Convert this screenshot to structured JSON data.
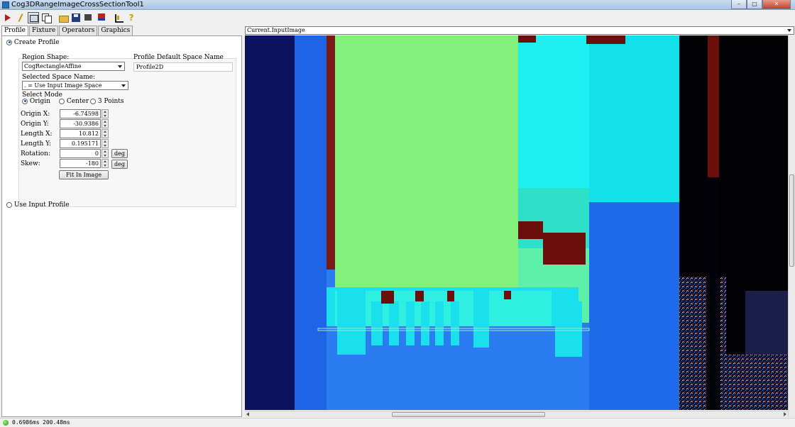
{
  "window": {
    "title": "Cog3DRangeImageCrossSectionTool1",
    "controls": [
      "–",
      "□",
      "✕"
    ]
  },
  "toolbar": {
    "icons": [
      "run-icon",
      "magic-wand-icon",
      "display-icon",
      "pages-icon",
      "open-folder-icon",
      "save-icon",
      "copy-icon",
      "flag-icon",
      "chart-icon",
      "help-icon"
    ]
  },
  "tabs": [
    "Profile",
    "Fixture",
    "Operators",
    "Graphics"
  ],
  "profile": {
    "create_profile_label": "Create Profile",
    "region_shape_label": "Region Shape:",
    "region_shape_value": "CogRectangleAffine",
    "default_space_label": "Profile Default Space Name",
    "default_space_value": "Profile2D",
    "selected_space_label": "Selected Space Name:",
    "selected_space_value": ". = Use Input Image Space",
    "select_mode_label": "Select Mode",
    "modes": [
      "Origin",
      "Center",
      "3 Points"
    ],
    "selected_mode": "Origin",
    "fields": [
      {
        "label": "Origin X:",
        "value": "-6.74598"
      },
      {
        "label": "Origin Y:",
        "value": "-30.9386"
      },
      {
        "label": "Length X:",
        "value": "10.812"
      },
      {
        "label": "Length Y:",
        "value": "0.195171"
      },
      {
        "label": "Rotation:",
        "value": "0",
        "unit": "deg"
      },
      {
        "label": "Skew:",
        "value": "-180",
        "unit": "deg"
      }
    ],
    "fit_button": "Fit In Image",
    "use_input_profile_label": "Use Input Profile"
  },
  "image_view": {
    "selected_view": "Current.InputImage",
    "scroll_mid": "III"
  },
  "status": {
    "indicator_color": "#1c9a16",
    "time1": "0.6986ms",
    "time2": "200.48ms"
  }
}
